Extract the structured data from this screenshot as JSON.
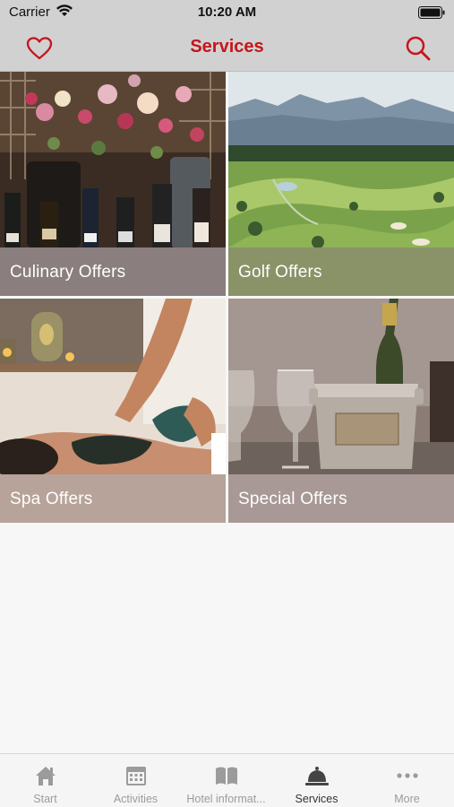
{
  "status_bar": {
    "carrier": "Carrier",
    "time": "10:20 AM"
  },
  "nav": {
    "title": "Services",
    "left_icon": "heart-icon",
    "right_icon": "search-icon",
    "accent": "#c4161c"
  },
  "tiles": [
    {
      "label": "Culinary Offers",
      "icon": "culinary-photo"
    },
    {
      "label": "Golf Offers",
      "icon": "golf-photo"
    },
    {
      "label": "Spa Offers",
      "icon": "spa-photo"
    },
    {
      "label": "Special Offers",
      "icon": "champagne-photo"
    }
  ],
  "tab_bar": {
    "items": [
      {
        "label": "Start",
        "icon": "home-icon",
        "active": false
      },
      {
        "label": "Activities",
        "icon": "calendar-icon",
        "active": false
      },
      {
        "label": "Hotel informat...",
        "icon": "book-icon",
        "active": false
      },
      {
        "label": "Services",
        "icon": "service-bell-icon",
        "active": true
      },
      {
        "label": "More",
        "icon": "more-dots-icon",
        "active": false
      }
    ]
  }
}
